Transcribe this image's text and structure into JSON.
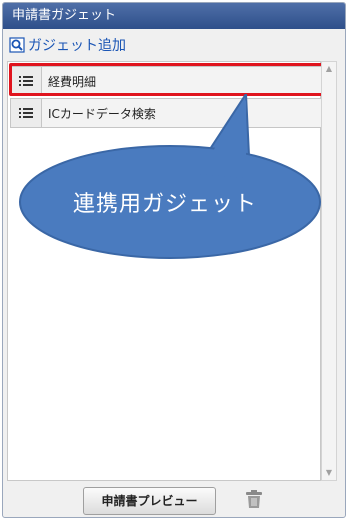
{
  "panel": {
    "title": "申請書ガジェット",
    "add_link_label": "ガジェット追加",
    "add_icon": "magnifier-icon",
    "items": [
      {
        "label": "経費明細",
        "icon": "list-icon",
        "highlighted": true
      },
      {
        "label": "ICカードデータ検索",
        "icon": "list-icon",
        "highlighted": false
      }
    ],
    "callout_text": "連携用ガジェット",
    "preview_button_label": "申請書プレビュー",
    "trash_icon": "trash-icon"
  },
  "colors": {
    "title_bar": "#3a5a96",
    "link": "#1a55b5",
    "highlight_border": "#e0141e",
    "callout_fill": "#4a7bbf"
  }
}
